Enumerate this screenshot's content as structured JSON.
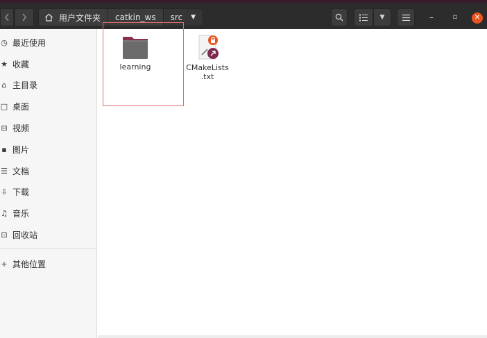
{
  "header": {
    "breadcrumbs": [
      {
        "label": "用户文件夹"
      },
      {
        "label": "catkin_ws"
      },
      {
        "label": "src"
      }
    ]
  },
  "sidebar": {
    "items": [
      {
        "label": "最近使用",
        "icon": "clock-icon"
      },
      {
        "label": "收藏",
        "icon": "star-icon"
      },
      {
        "label": "主目录",
        "icon": "home-icon"
      },
      {
        "label": "桌面",
        "icon": "desktop-icon"
      },
      {
        "label": "视频",
        "icon": "video-icon"
      },
      {
        "label": "图片",
        "icon": "image-icon"
      },
      {
        "label": "文档",
        "icon": "document-icon"
      },
      {
        "label": "下载",
        "icon": "download-icon"
      },
      {
        "label": "音乐",
        "icon": "music-icon"
      },
      {
        "label": "回收站",
        "icon": "trash-icon"
      }
    ],
    "other": {
      "label": "其他位置",
      "icon": "plus-icon"
    }
  },
  "files": [
    {
      "name": "learning",
      "type": "folder"
    },
    {
      "name_line1": "CMakeLists",
      "name_line2": ".txt",
      "type": "text-file-locked-link"
    }
  ],
  "colors": {
    "accent": "#e95420",
    "folder": "#6b6b6b",
    "folder_tab": "#8b2f4f",
    "headerbar": "#2c2c2c"
  }
}
